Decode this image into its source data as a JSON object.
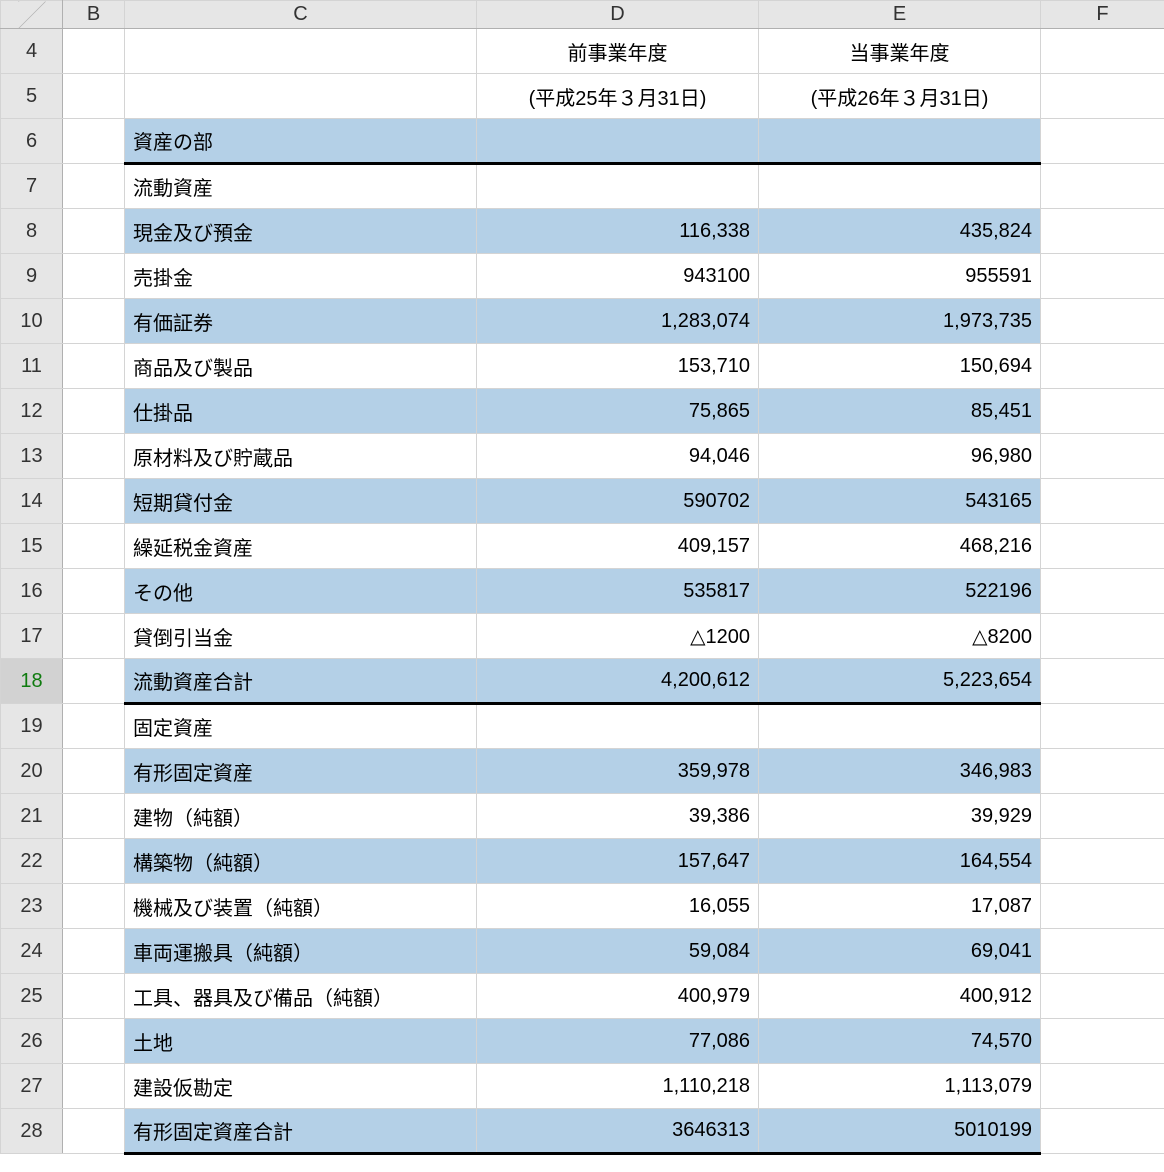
{
  "columns": [
    "B",
    "C",
    "D",
    "E",
    "F"
  ],
  "row_numbers": [
    4,
    5,
    6,
    7,
    8,
    9,
    10,
    11,
    12,
    13,
    14,
    15,
    16,
    17,
    18,
    19,
    20,
    21,
    22,
    23,
    24,
    25,
    26,
    27,
    28
  ],
  "selected_row": 18,
  "header": {
    "d1": "前事業年度",
    "e1": "当事業年度",
    "d2": "(平成25年３月31日)",
    "e2": "(平成26年３月31日)"
  },
  "sections": {
    "assets": "資産の部",
    "current_assets": "流動資産",
    "fixed_assets": "固定資産"
  },
  "rows": [
    {
      "label": "現金及び預金",
      "d": "116,338",
      "e": "435,824",
      "shaded": true
    },
    {
      "label": "売掛金",
      "d": "943100",
      "e": "955591",
      "shaded": false
    },
    {
      "label": "有価証券",
      "d": "1,283,074",
      "e": "1,973,735",
      "shaded": true
    },
    {
      "label": "商品及び製品",
      "d": "153,710",
      "e": "150,694",
      "shaded": false
    },
    {
      "label": "仕掛品",
      "d": "75,865",
      "e": "85,451",
      "shaded": true
    },
    {
      "label": "原材料及び貯蔵品",
      "d": "94,046",
      "e": "96,980",
      "shaded": false
    },
    {
      "label": "短期貸付金",
      "d": "590702",
      "e": "543165",
      "shaded": true
    },
    {
      "label": "繰延税金資産",
      "d": "409,157",
      "e": "468,216",
      "shaded": false
    },
    {
      "label": "その他",
      "d": "535817",
      "e": "522196",
      "shaded": true
    },
    {
      "label": "貸倒引当金",
      "d": "△1200",
      "e": "△8200",
      "shaded": false
    },
    {
      "label": "流動資産合計",
      "d": "4,200,612",
      "e": "5,223,654",
      "shaded": true,
      "thick": true
    },
    {
      "label": "有形固定資産",
      "d": "359,978",
      "e": "346,983",
      "shaded": true
    },
    {
      "label": "建物（純額）",
      "d": "39,386",
      "e": "39,929",
      "shaded": false
    },
    {
      "label": "構築物（純額）",
      "d": "157,647",
      "e": "164,554",
      "shaded": true
    },
    {
      "label": "機械及び装置（純額）",
      "d": "16,055",
      "e": "17,087",
      "shaded": false
    },
    {
      "label": "車両運搬具（純額）",
      "d": "59,084",
      "e": "69,041",
      "shaded": true
    },
    {
      "label": "工具、器具及び備品（純額）",
      "d": "400,979",
      "e": "400,912",
      "shaded": false
    },
    {
      "label": "土地",
      "d": "77,086",
      "e": "74,570",
      "shaded": true
    },
    {
      "label": "建設仮勘定",
      "d": "1,110,218",
      "e": "1,113,079",
      "shaded": false
    },
    {
      "label": "有形固定資産合計",
      "d": "3646313",
      "e": "5010199",
      "shaded": true,
      "thick": true
    }
  ]
}
